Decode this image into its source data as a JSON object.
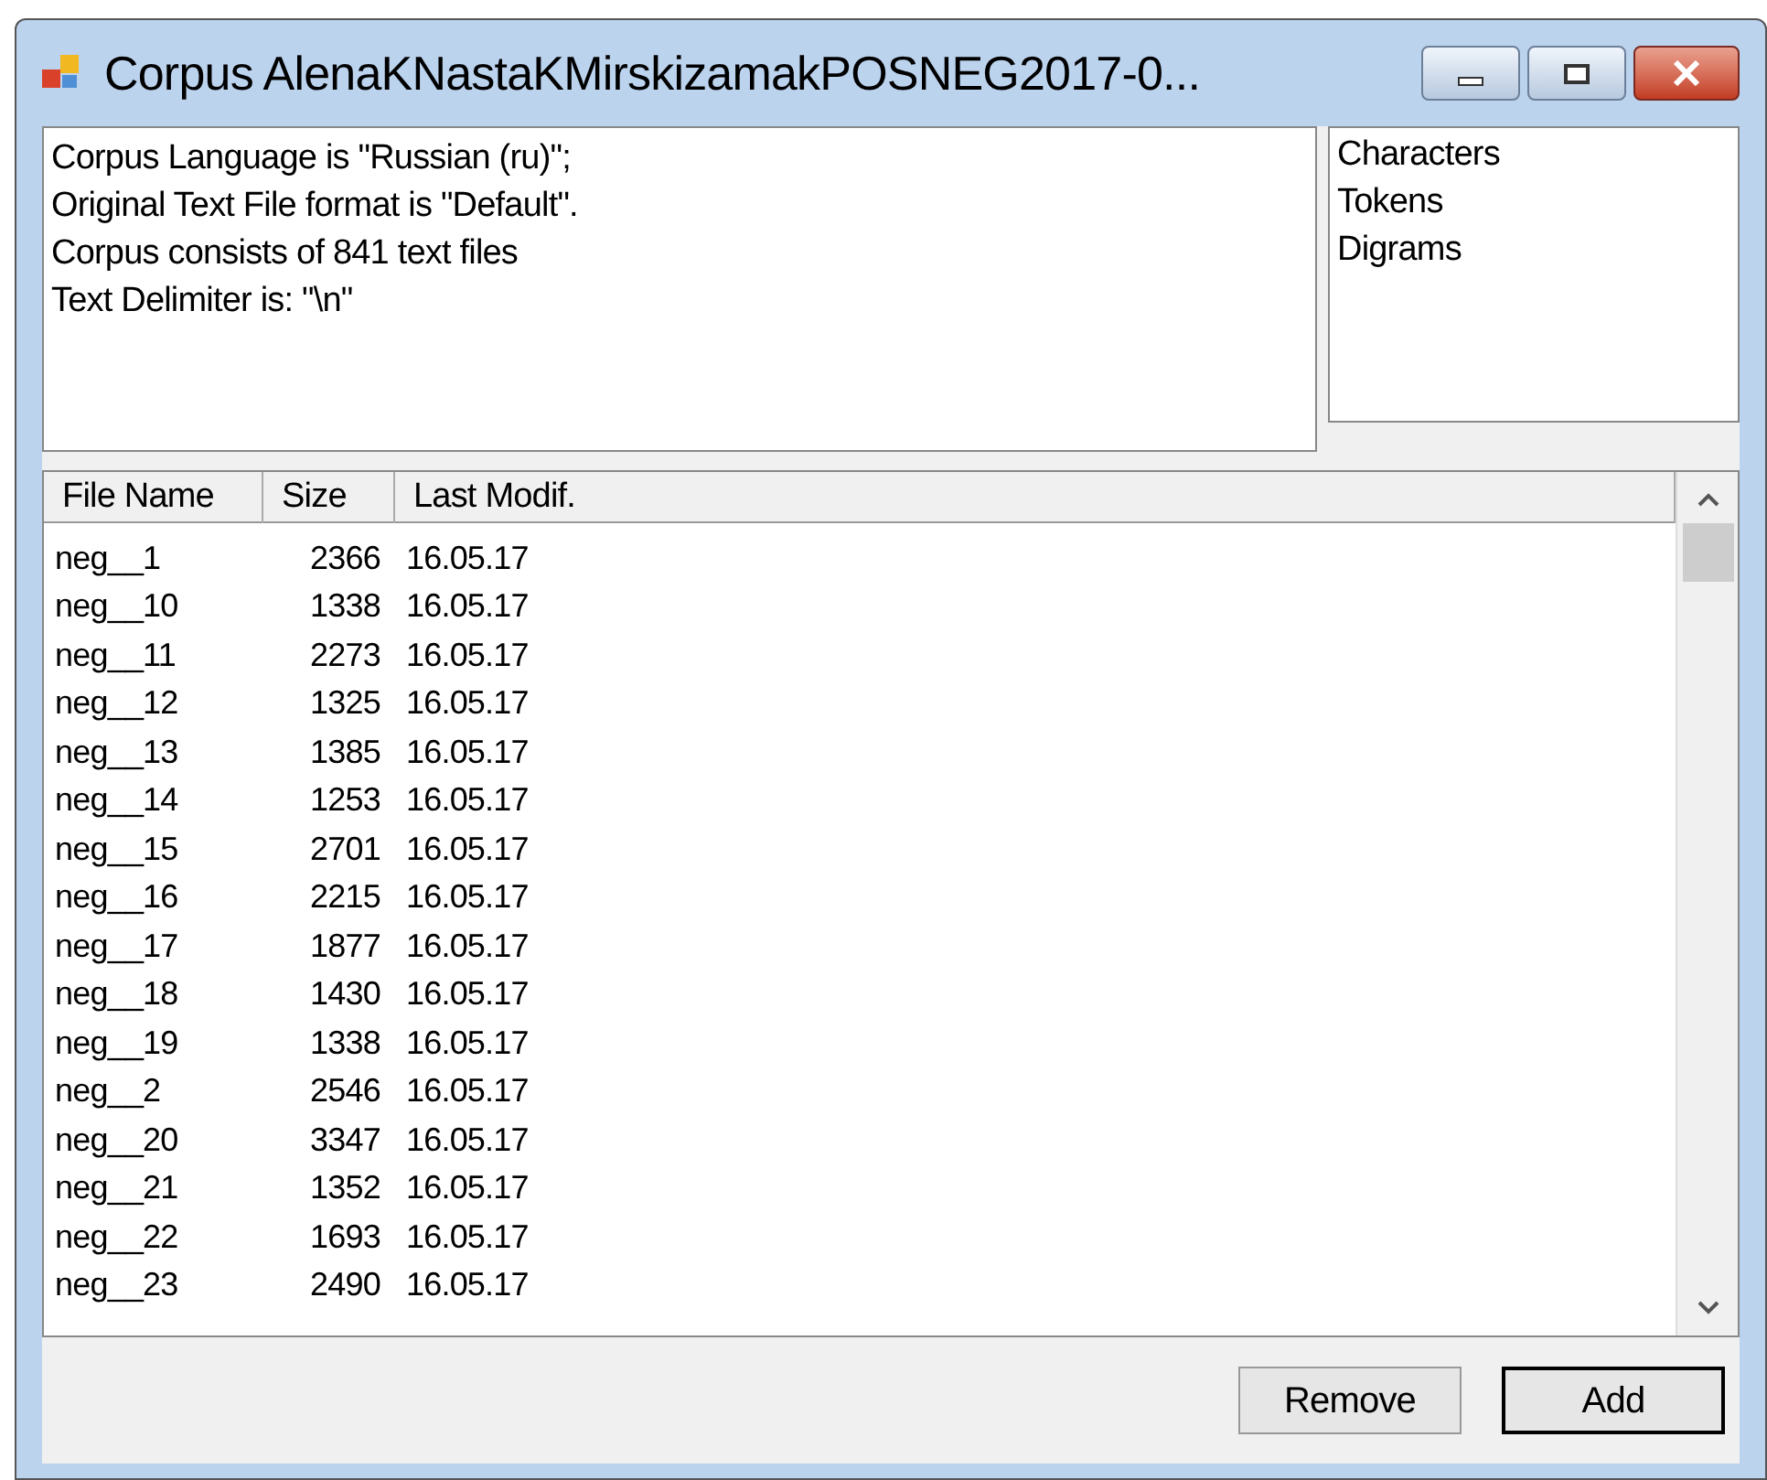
{
  "window": {
    "title": "Corpus AlenaKNastaKMirskizamakPOSNEG2017-0..."
  },
  "info_lines": [
    "Corpus Language is \"Russian (ru)\";",
    "Original Text File format is \"Default\".",
    "Corpus consists of 841 text files",
    "Text Delimiter is: \"\\n\""
  ],
  "stats_list": [
    "Characters",
    "Tokens",
    "Digrams"
  ],
  "table": {
    "columns": [
      "File Name",
      "Size",
      "Last Modif."
    ],
    "rows": [
      [
        "neg__1",
        "2366",
        "16.05.17"
      ],
      [
        "neg__10",
        "1338",
        "16.05.17"
      ],
      [
        "neg__11",
        "2273",
        "16.05.17"
      ],
      [
        "neg__12",
        "1325",
        "16.05.17"
      ],
      [
        "neg__13",
        "1385",
        "16.05.17"
      ],
      [
        "neg__14",
        "1253",
        "16.05.17"
      ],
      [
        "neg__15",
        "2701",
        "16.05.17"
      ],
      [
        "neg__16",
        "2215",
        "16.05.17"
      ],
      [
        "neg__17",
        "1877",
        "16.05.17"
      ],
      [
        "neg__18",
        "1430",
        "16.05.17"
      ],
      [
        "neg__19",
        "1338",
        "16.05.17"
      ],
      [
        "neg__2",
        "2546",
        "16.05.17"
      ],
      [
        "neg__20",
        "3347",
        "16.05.17"
      ],
      [
        "neg__21",
        "1352",
        "16.05.17"
      ],
      [
        "neg__22",
        "1693",
        "16.05.17"
      ],
      [
        "neg__23",
        "2490",
        "16.05.17"
      ]
    ]
  },
  "buttons": [
    {
      "label": "Remove",
      "default": false
    },
    {
      "label": "Add",
      "default": true
    }
  ]
}
